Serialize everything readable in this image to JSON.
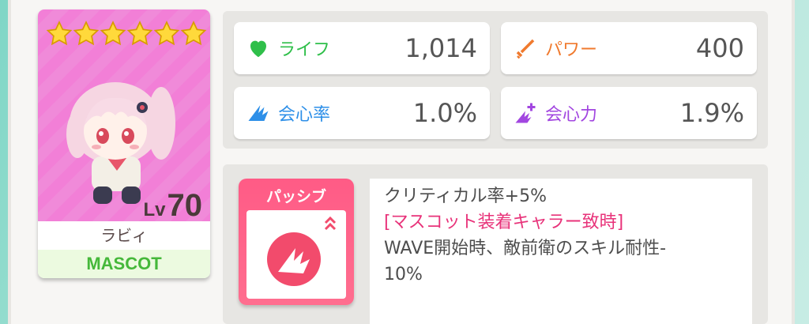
{
  "card": {
    "stars": 6,
    "level_prefix": "Lv",
    "level": "70",
    "name": "ラビィ",
    "type": "MASCOT"
  },
  "stats": [
    {
      "label": "ライフ",
      "value": "1,014",
      "icon": "heart-icon",
      "color": "#2fbf4a"
    },
    {
      "label": "パワー",
      "value": "400",
      "icon": "sword-icon",
      "color": "#f07a2e"
    },
    {
      "label": "会心率",
      "value": "1.0%",
      "icon": "crit-rate-icon",
      "color": "#2d8fe8"
    },
    {
      "label": "会心力",
      "value": "1.9%",
      "icon": "crit-power-icon",
      "color": "#a246e0"
    }
  ],
  "passive": {
    "badge_label": "パッシブ",
    "line1": "クリティカル率+5%",
    "line2": "[マスコット装着キャラー致時]",
    "line3": "WAVE開始時、敵前衛のスキル耐性-",
    "line4": "10%"
  }
}
